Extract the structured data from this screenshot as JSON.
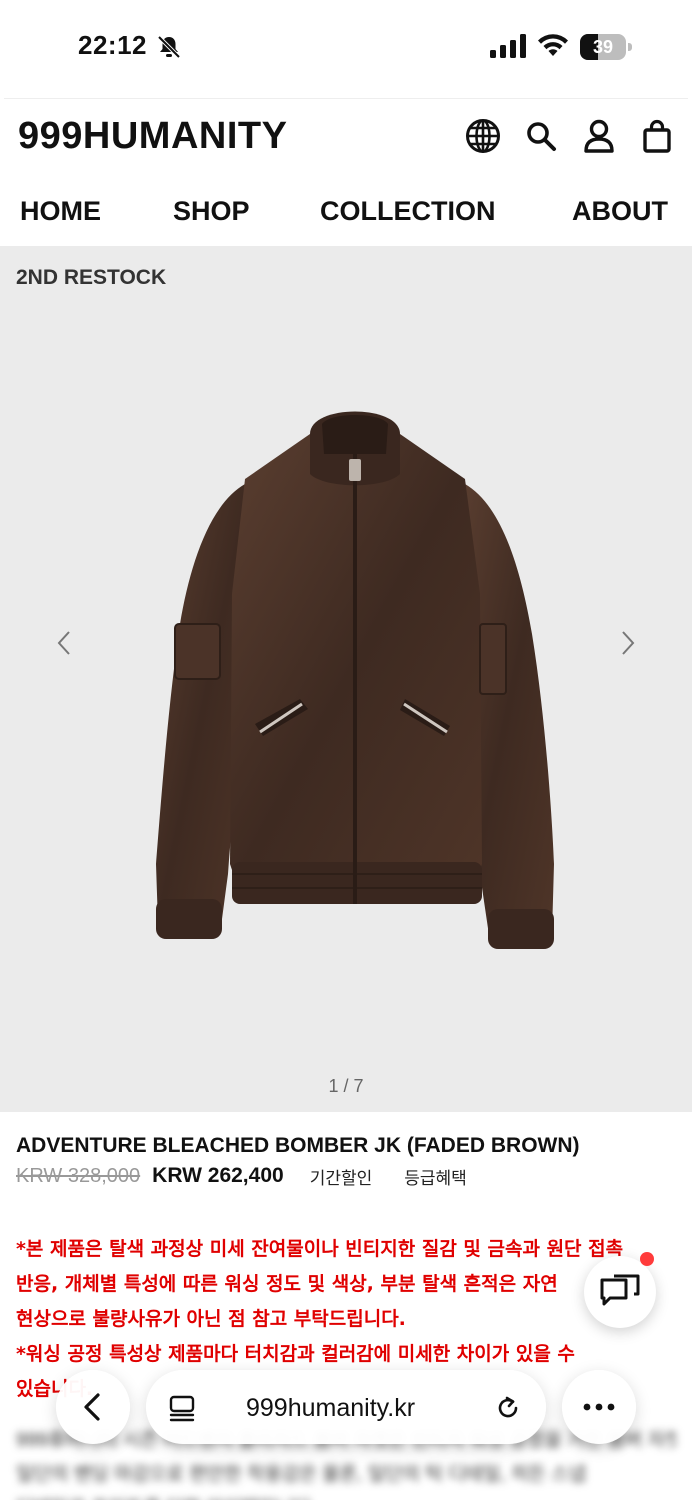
{
  "status_bar": {
    "time": "22:12",
    "battery_level": "39",
    "battery_fraction": 0.39,
    "icons": [
      "bell-slash-icon",
      "cellular-signal-icon",
      "wifi-icon",
      "battery-icon"
    ]
  },
  "header": {
    "logo": "999HUMANITY",
    "icons": [
      "globe-icon",
      "search-icon",
      "account-icon",
      "bag-icon"
    ]
  },
  "nav": {
    "items": [
      {
        "label": "HOME"
      },
      {
        "label": "SHOP"
      },
      {
        "label": "COLLECTION"
      },
      {
        "label": "ABOUT"
      }
    ]
  },
  "gallery": {
    "badge": "2ND RESTOCK",
    "counter": "1 / 7",
    "icons": [
      "chevron-left-icon",
      "chevron-right-icon"
    ]
  },
  "product": {
    "name": "ADVENTURE BLEACHED BOMBER JK (FADED BROWN)",
    "original_price": "KRW 328,000",
    "sale_price": "KRW 262,400",
    "tags": [
      "기간할인",
      "등급혜택"
    ]
  },
  "notice": {
    "lines": [
      "*본 제품은 탈색 과정상 미세 잔여물이나 빈티지한 질감 및 금속과 원단 접촉",
      "반응, 개체별 특성에 따른 워싱 정도 및 색상, 부분 탈색 흔적은 자연",
      "현상으로 불량사유가 아닌 점 참고 부탁드립니다.",
      "*워싱 공정 특성상 제품마다 터치감과 컬러감에 미세한 차이가 있을 수",
      "있습니다."
    ]
  },
  "description": {
    "lines": [
      "999휴머니티 시즌 어드벤처 블리치드 봄버 자켓은 빈티지 워싱 공정을 거친 봄버 자켓으로",
      "일단의 밴딩 마감으로 편안한 착용감은 물론, 일단의 턱 디테일, 히든 스냅",
      "디테일로 포인트를 더한 아이템입니다."
    ]
  },
  "browser": {
    "url": "999humanity.kr",
    "icons": [
      "back-icon",
      "tabs-icon",
      "reload-icon",
      "more-icon"
    ]
  },
  "colors": {
    "accent_red": "#e00000",
    "gallery_bg": "#ebebeb",
    "jacket_brown": "#4a3227"
  }
}
